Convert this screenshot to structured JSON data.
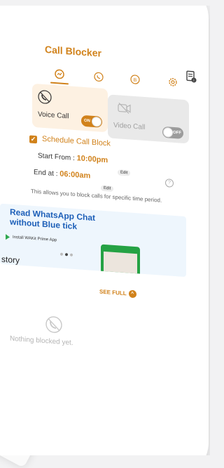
{
  "app": {
    "title": "Call Blocker"
  },
  "tabs": [
    {
      "name": "messenger-icon"
    },
    {
      "name": "whatsapp-icon"
    },
    {
      "name": "business-icon"
    },
    {
      "name": "settings-icon"
    }
  ],
  "header": {
    "report_icon": "report-icon"
  },
  "voice_card": {
    "label": "Voice Call",
    "toggle": "ON"
  },
  "video_card": {
    "label": "Video Call",
    "toggle": "OFF"
  },
  "schedule": {
    "title": "Schedule Call Block",
    "start_label": "Start From :",
    "start_time": "10:00pm",
    "end_label": "End at :",
    "end_time": "06:00am",
    "edit_label": "Edit",
    "description": "This allows you to block calls for specific time period."
  },
  "ad": {
    "headline": "Read WhatsApp Chat without Blue tick",
    "sub": "Install WAKit Prime App"
  },
  "history": {
    "label": "story",
    "see_full": "SEE FULL",
    "empty_text": "Nothing blocked yet."
  },
  "colors": {
    "accent": "#d1821b",
    "ad_blue": "#1d5fb8"
  }
}
